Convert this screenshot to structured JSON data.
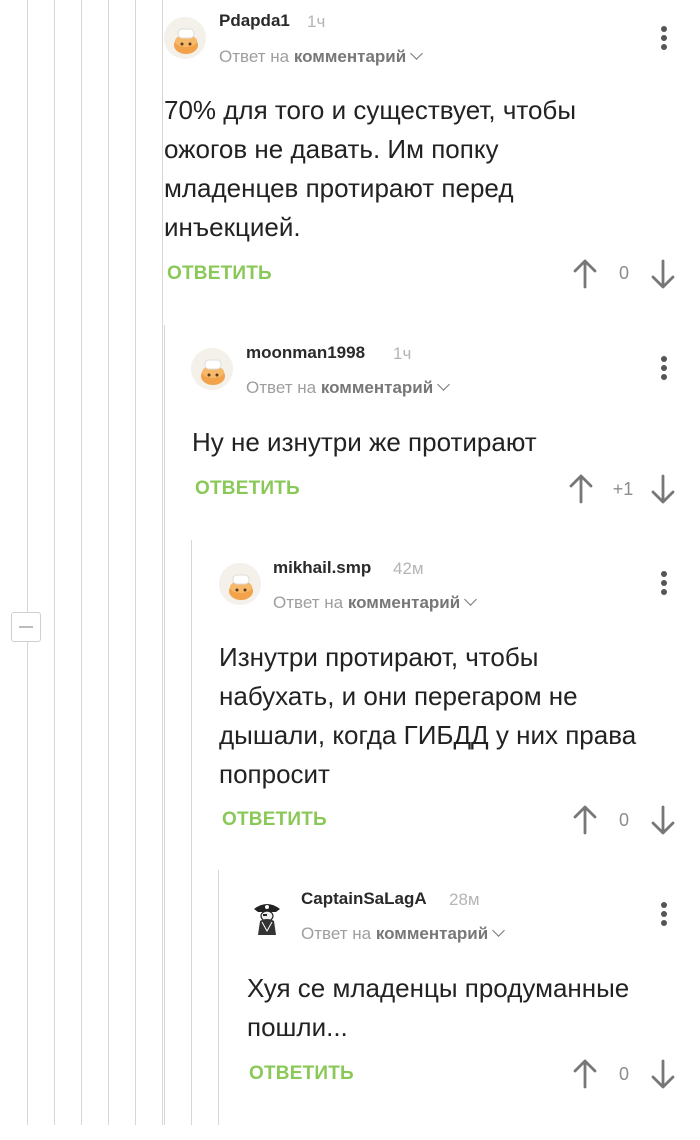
{
  "labels": {
    "reply_prefix": "Ответ на",
    "reply_target": "комментарий",
    "reply_action": "ОТВЕТИТЬ"
  },
  "comments": [
    {
      "username": "Pdapda1",
      "time": "1ч",
      "text": "70% для того и существует, чтобы\nожогов не давать. Им попку\nмладенцев протирают перед\nинъекцией.",
      "rating": "0",
      "avatar": "chef-bun-avatar"
    },
    {
      "username": "moonman1998",
      "time": "1ч",
      "text": "Ну не изнутри же протирают",
      "rating": "+1",
      "avatar": "chef-bun-avatar"
    },
    {
      "username": "mikhail.smp",
      "time": "42м",
      "text": "Изнутри протирают, чтобы\nнабухать, и они перегаром не\nдышали, когда ГИБДД у них права\nпопросит",
      "rating": "0",
      "avatar": "chef-bun-avatar"
    },
    {
      "username": "CaptainSaLagA",
      "time": "28м",
      "text": "Хуя се младенцы продуманные\nпошли...",
      "rating": "0",
      "avatar": "pirate-captain-avatar"
    }
  ],
  "colors": {
    "accent_green": "#8ac858",
    "thread_line": "#d7d7d7",
    "text": "#222222",
    "muted": "#9e9e9e"
  },
  "icons": [
    "collapse-thread-icon",
    "more-options-icon",
    "upvote-arrow-icon",
    "downvote-arrow-icon",
    "chevron-down-icon"
  ]
}
